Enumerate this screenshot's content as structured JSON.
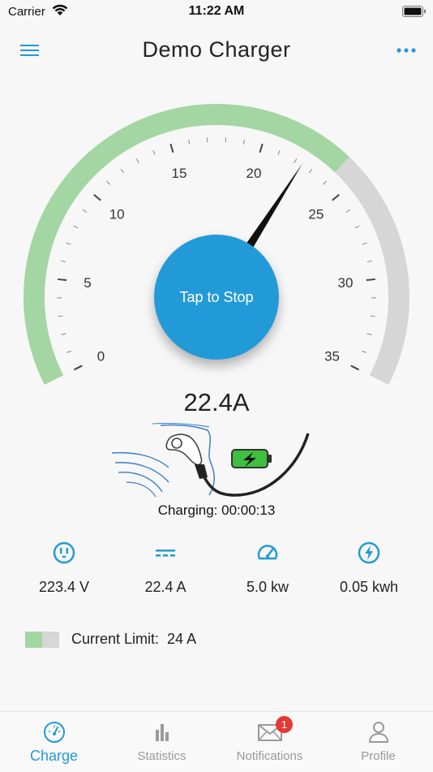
{
  "status_bar": {
    "carrier": "Carrier",
    "time": "11:22 AM"
  },
  "header": {
    "title": "Demo Charger"
  },
  "gauge": {
    "min": 0,
    "max": 35,
    "value": 22.4,
    "limit": 24,
    "tick_labels": [
      "0",
      "5",
      "10",
      "15",
      "20",
      "25",
      "30",
      "35"
    ],
    "colors": {
      "active": "#a3d6a2",
      "remaining": "#d6d6d6",
      "needle": "#111111"
    }
  },
  "action_button": {
    "label": "Tap to Stop",
    "color": "#239ad8"
  },
  "current_reading": "22.4A",
  "charging_status": "Charging: 00:00:13",
  "stats": [
    {
      "icon": "outlet-icon",
      "value": "223.4 V"
    },
    {
      "icon": "dc-current-icon",
      "value": "22.4 A"
    },
    {
      "icon": "speedometer-icon",
      "value": "5.0 kw"
    },
    {
      "icon": "lightning-icon",
      "value": "0.05 kwh"
    }
  ],
  "current_limit": {
    "label": "Current Limit:",
    "value": "24 A"
  },
  "tabs": [
    {
      "label": "Charge",
      "icon": "gauge-icon",
      "active": true
    },
    {
      "label": "Statistics",
      "icon": "bar-chart-icon",
      "active": false
    },
    {
      "label": "Notifications",
      "icon": "mail-icon",
      "active": false,
      "badge": "1"
    },
    {
      "label": "Profile",
      "icon": "person-icon",
      "active": false
    }
  ],
  "accent_color": "#239ad8"
}
